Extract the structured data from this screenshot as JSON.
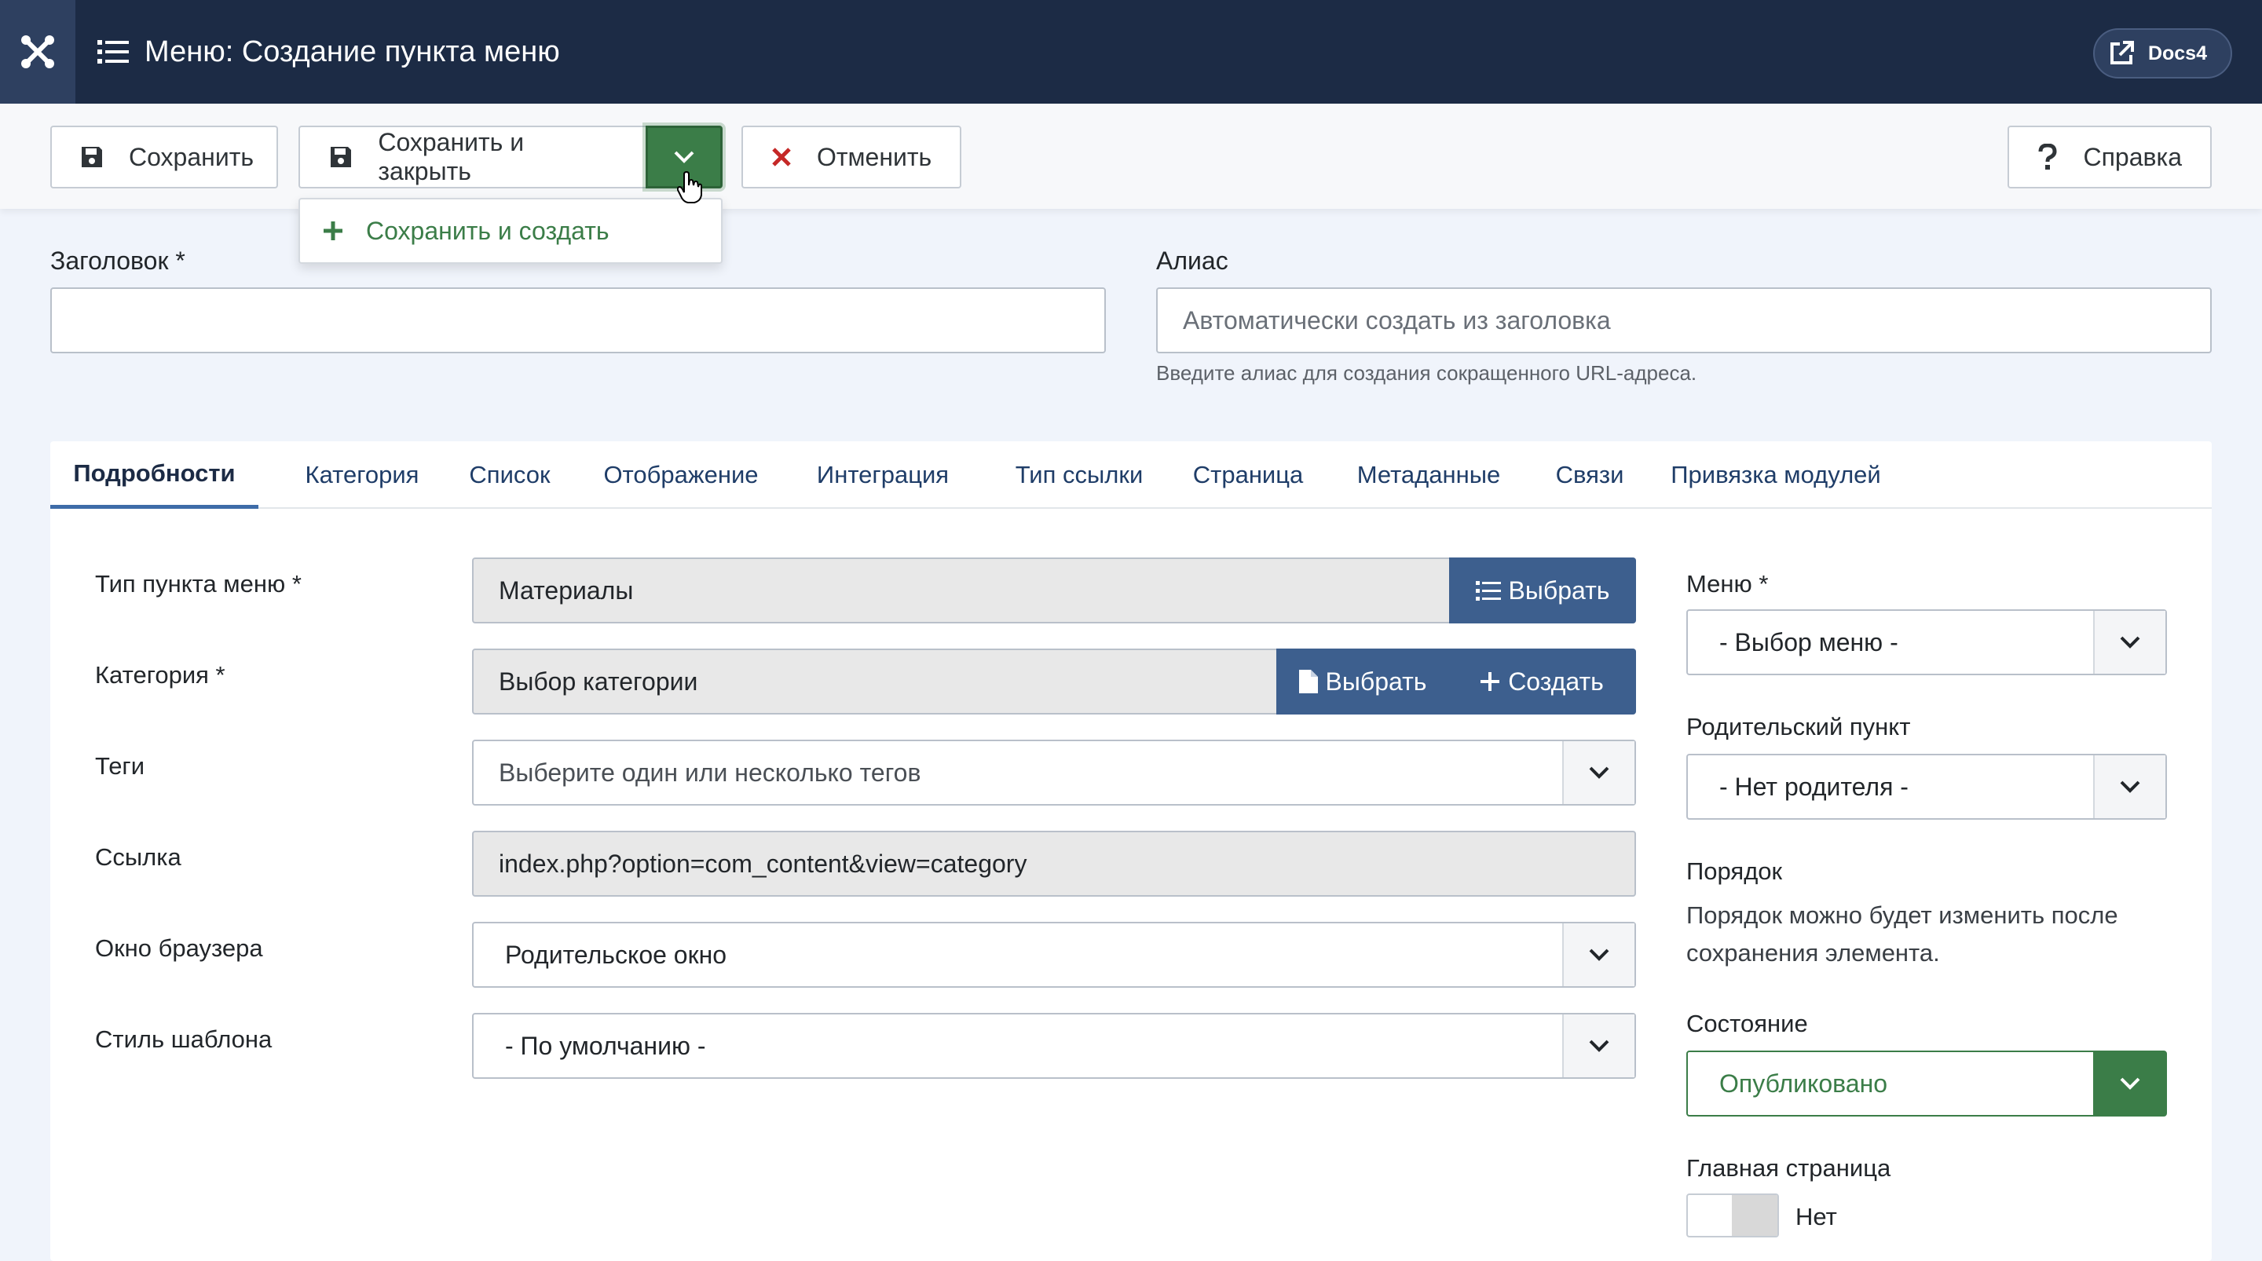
{
  "header": {
    "title": "Меню: Создание пункта меню",
    "site_button": "Docs4"
  },
  "toolbar": {
    "save": "Сохранить",
    "save_close": "Сохранить и закрыть",
    "cancel": "Отменить",
    "help": "Справка",
    "dropdown_item": "Сохранить и создать"
  },
  "fields": {
    "title_label": "Заголовок *",
    "title_value": "",
    "alias_label": "Алиас",
    "alias_placeholder": "Автоматически создать из заголовка",
    "alias_hint": "Введите алиас для создания сокращенного URL-адреса."
  },
  "tabs": [
    "Подробности",
    "Категория",
    "Список",
    "Отображение",
    "Интеграция",
    "Тип ссылки",
    "Страница",
    "Метаданные",
    "Связи",
    "Привязка модулей"
  ],
  "details": {
    "menu_item_type_label": "Тип пункта меню *",
    "menu_item_type_value": "Материалы",
    "select_button": "Выбрать",
    "category_label": "Категория *",
    "category_value": "Выбор категории",
    "category_select_button": "Выбрать",
    "category_create_button": "Создать",
    "tags_label": "Теги",
    "tags_placeholder": "Выберите один или несколько тегов",
    "link_label": "Ссылка",
    "link_value": "index.php?option=com_content&view=category",
    "browser_window_label": "Окно браузера",
    "browser_window_value": "Родительское окно",
    "template_style_label": "Стиль шаблона",
    "template_style_value": "- По умолчанию -"
  },
  "sidebar": {
    "menu_label": "Меню *",
    "menu_value": "- Выбор меню -",
    "parent_label": "Родительский пункт",
    "parent_value": "- Нет родителя -",
    "order_label": "Порядок",
    "order_text": "Порядок можно будет изменить после сохранения элемента.",
    "status_label": "Состояние",
    "status_value": "Опубликовано",
    "home_label": "Главная страница",
    "home_value": "Нет"
  },
  "colors": {
    "header_bg": "#1c2b45",
    "accent_green": "#3b7d48",
    "accent_blue": "#3d5f8e"
  }
}
